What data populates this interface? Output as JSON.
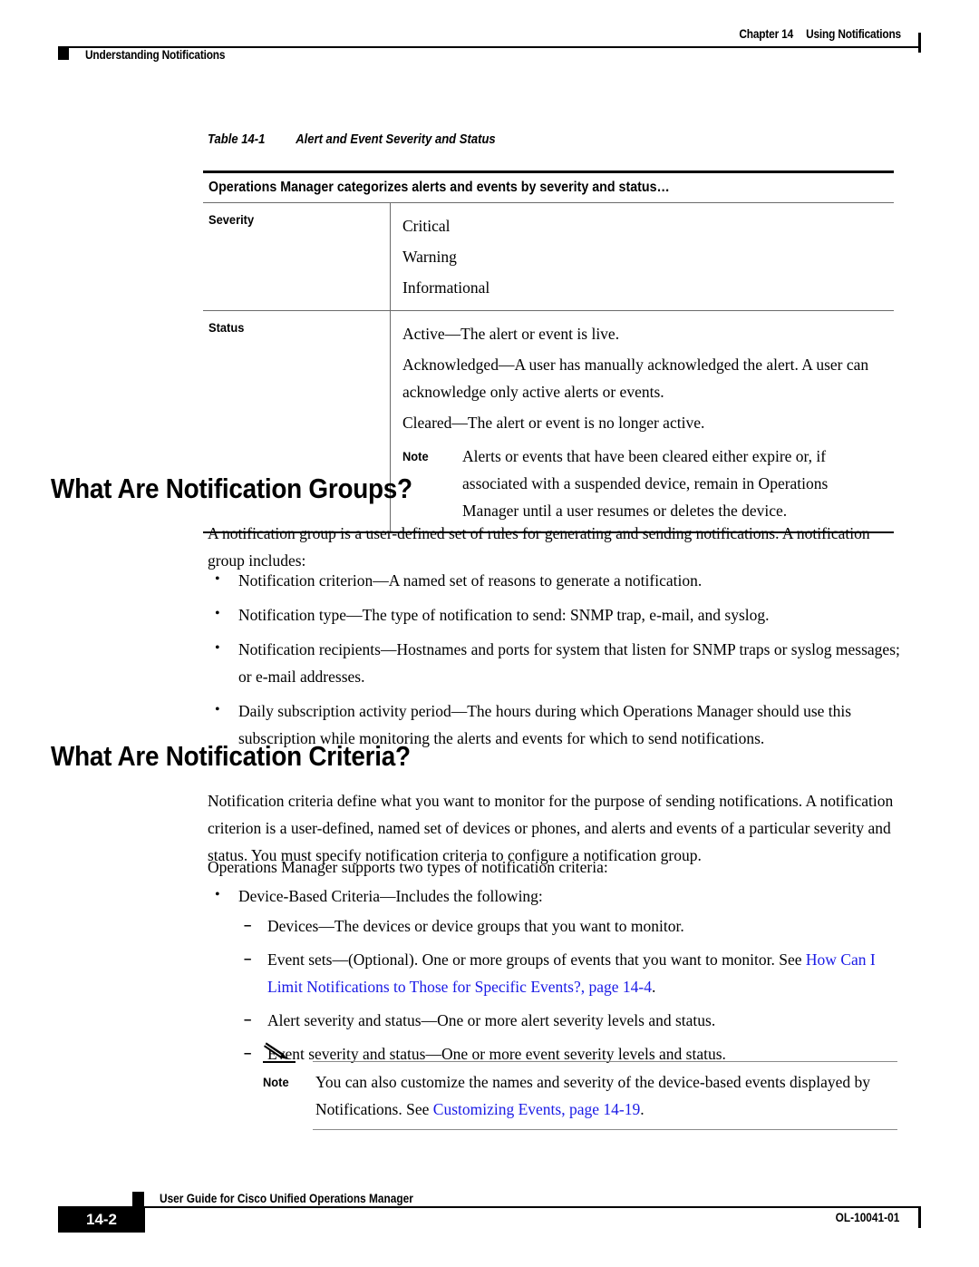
{
  "header": {
    "chapter": "Chapter 14",
    "chapter_title": "Using Notifications",
    "section_label": "Understanding Notifications"
  },
  "table": {
    "caption_number": "Table 14-1",
    "caption_title": "Alert and Event Severity and Status",
    "header_row": "Operations Manager categorizes alerts and events by severity and status…",
    "rows": [
      {
        "label": "Severity",
        "items": [
          "Critical",
          "Warning",
          "Informational"
        ]
      },
      {
        "label": "Status",
        "items": [
          "Active—The alert or event is live.",
          "Acknowledged—A user has manually acknowledged the alert. A user can acknowledge only active alerts or events.",
          "Cleared—The alert or event is no longer active."
        ],
        "note_label": "Note",
        "note_text": "Alerts or events that have been cleared either expire or, if associated with a suspended device, remain in Operations Manager until a user resumes or deletes the device."
      }
    ]
  },
  "section_groups": {
    "heading": "What Are Notification Groups?",
    "intro": "A notification group is a user-defined set of rules for generating and sending notifications. A notification group includes:",
    "bullets": [
      "Notification criterion—A named set of reasons to generate a notification.",
      "Notification type—The type of notification to send: SNMP trap, e-mail, and syslog.",
      "Notification recipients—Hostnames and ports for system that listen for SNMP traps or syslog messages; or e-mail addresses.",
      "Daily subscription activity period—The hours during which Operations Manager should use this subscription while monitoring the alerts and events for which to send notifications."
    ]
  },
  "section_criteria": {
    "heading": "What Are Notification Criteria?",
    "para1": "Notification criteria define what you want to monitor for the purpose of sending notifications. A notification criterion is a user-defined, named set of devices or phones, and alerts and events of a particular severity and status. You must specify notification criteria to configure a notification group.",
    "para2": "Operations Manager supports two types of notification criteria:",
    "bullet1": "Device-Based Criteria—Includes the following:",
    "sub_items": [
      {
        "text_before": "Devices—The devices or device groups that you want to monitor.",
        "link": "",
        "text_after": ""
      },
      {
        "text_before": "Event sets—(Optional). One or more groups of events that you want to monitor. See ",
        "link": "How Can I Limit Notifications to Those for Specific Events?, page 14-4",
        "text_after": "."
      },
      {
        "text_before": "Alert severity and status—One or more alert severity levels and status.",
        "link": "",
        "text_after": ""
      },
      {
        "text_before": "Event severity and status—One or more event severity levels and status.",
        "link": "",
        "text_after": ""
      }
    ]
  },
  "bottom_note": {
    "label": "Note",
    "text_before": "You can also customize the names and severity of the device-based events displayed by Notifications. See ",
    "link": "Customizing Events, page 14-19",
    "text_after": "."
  },
  "footer": {
    "guide_title": "User Guide for Cisco Unified Operations Manager",
    "page_number": "14-2",
    "doc_id": "OL-10041-01"
  },
  "colors": {
    "link": "#1a1ae6",
    "rule": "#000000"
  }
}
